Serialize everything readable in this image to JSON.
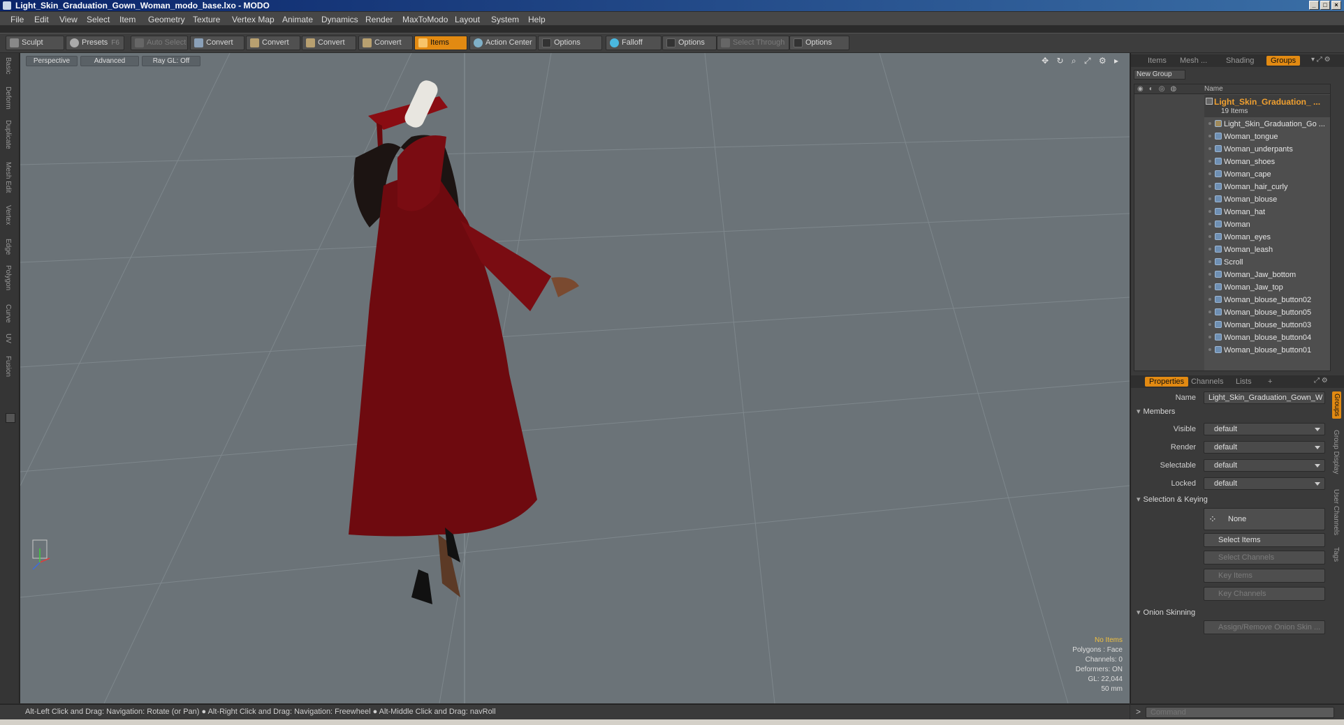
{
  "window": {
    "title": "Light_Skin_Graduation_Gown_Woman_modo_base.lxo - MODO"
  },
  "menu": [
    "File",
    "Edit",
    "View",
    "Select",
    "Item",
    "Geometry",
    "Texture",
    "Vertex Map",
    "Animate",
    "Dynamics",
    "Render",
    "MaxToModo",
    "Layout",
    "System",
    "Help"
  ],
  "toolbar": {
    "sculpt": "Sculpt",
    "presets": "Presets",
    "presets_key": "F6",
    "auto_select": "Auto Select",
    "convert": "Convert",
    "items": "Items",
    "action_center": "Action Center",
    "options": "Options",
    "falloff": "Falloff",
    "select_through": "Select Through"
  },
  "left_tabs": [
    "Basic",
    "Deform",
    "Duplicate",
    "Mesh Edit",
    "Vertex",
    "Edge",
    "Polygon",
    "Curve",
    "UV",
    "Fusion"
  ],
  "viewport": {
    "view": "Perspective",
    "shading": "Advanced",
    "raygl": "Ray GL: Off",
    "info": {
      "no_items": "No Items",
      "polygons": "Polygons : Face",
      "channels": "Channels: 0",
      "deformers": "Deformers: ON",
      "gl": "GL: 22,044",
      "focal": "50 mm"
    }
  },
  "panel_top": {
    "tabs": [
      "Items",
      "Mesh ...",
      "Shading",
      "Groups"
    ],
    "new_group": "New Group",
    "name_header": "Name",
    "group": {
      "name": "Light_Skin_Graduation_ ...",
      "count": "19 Items"
    },
    "items": [
      "Light_Skin_Graduation_Go ...",
      "Woman_tongue",
      "Woman_underpants",
      "Woman_shoes",
      "Woman_cape",
      "Woman_hair_curly",
      "Woman_blouse",
      "Woman_hat",
      "Woman",
      "Woman_eyes",
      "Woman_leash",
      "Scroll",
      "Woman_Jaw_bottom",
      "Woman_Jaw_top",
      "Woman_blouse_button02",
      "Woman_blouse_button05",
      "Woman_blouse_button03",
      "Woman_blouse_button04",
      "Woman_blouse_button01"
    ]
  },
  "panel_props": {
    "tabs": [
      "Properties",
      "Channels",
      "Lists",
      "+"
    ],
    "name_label": "Name",
    "name_value": "Light_Skin_Graduation_Gown_W",
    "members": "Members",
    "visible_label": "Visible",
    "render_label": "Render",
    "selectable_label": "Selectable",
    "locked_label": "Locked",
    "default_value": "default",
    "selection_keying": "Selection & Keying",
    "none_label": "None",
    "select_items": "Select Items",
    "select_channels": "Select Channels",
    "key_items": "Key Items",
    "key_channels": "Key Channels",
    "onion_skinning": "Onion Skinning",
    "assign_onion": "Assign/Remove Onion Skin ...",
    "side_tabs": [
      "Groups",
      "Group Display",
      "User Channels",
      "Tags"
    ]
  },
  "status": {
    "hint": "Alt-Left Click and Drag: Navigation: Rotate (or Pan) ● Alt-Right Click and Drag: Navigation: Freewheel ● Alt-Middle Click and Drag: navRoll"
  },
  "command": {
    "placeholder": "Command",
    "prompt": ">"
  },
  "colors": {
    "accent": "#e28a12",
    "gown": "#7a0a10",
    "viewport": "#6b7378",
    "group_name": "#f0a030"
  }
}
